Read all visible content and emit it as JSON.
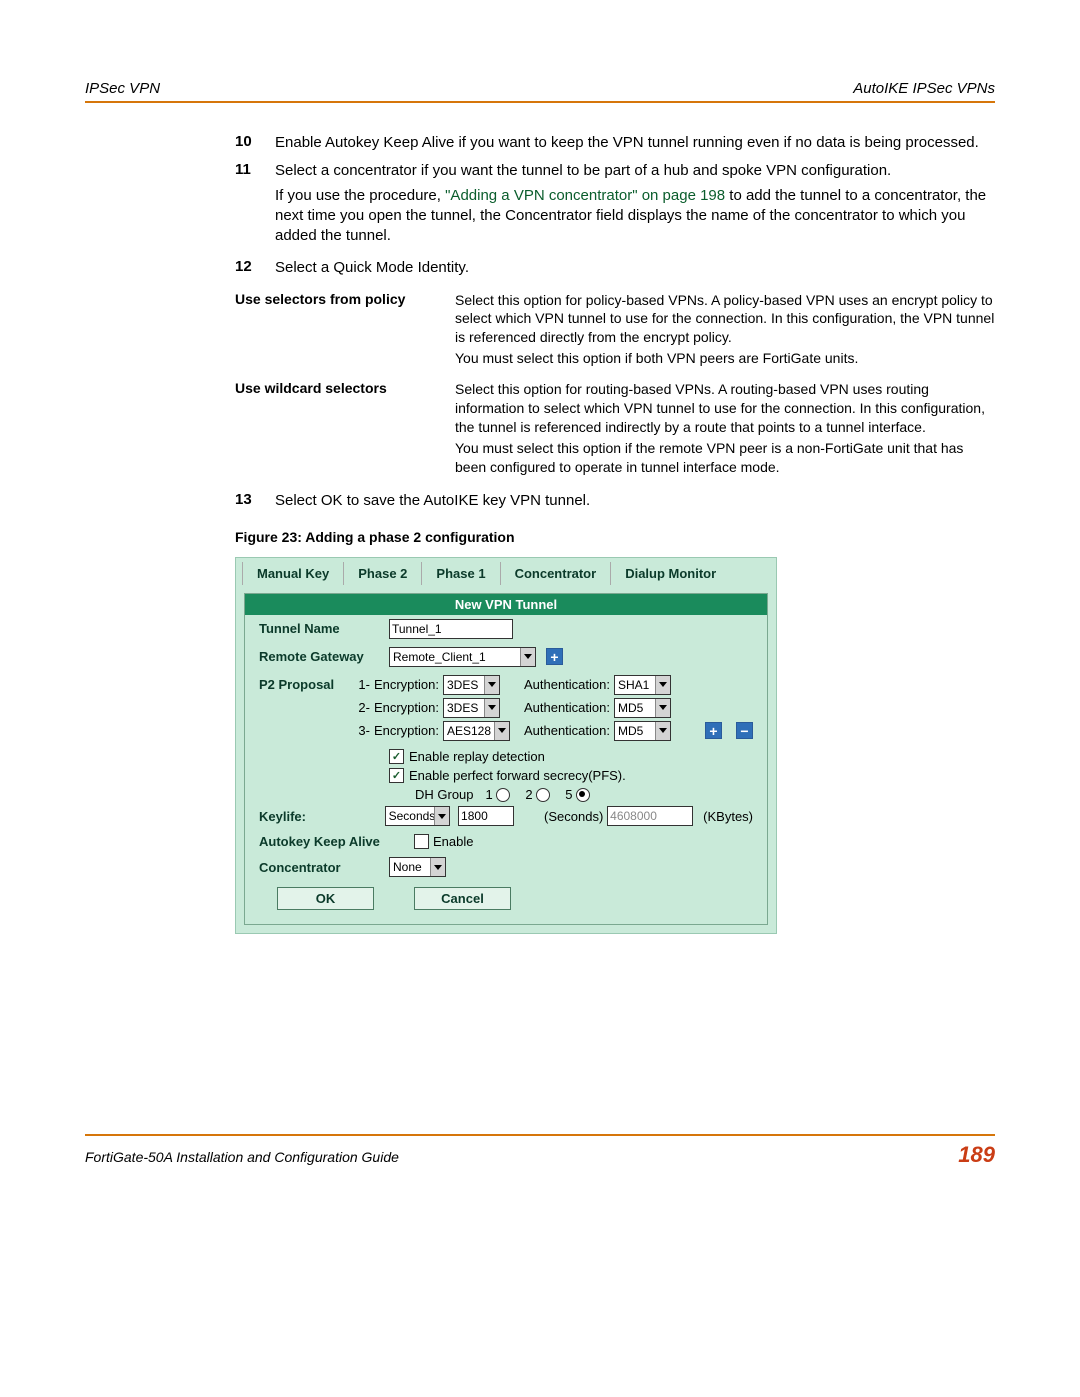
{
  "header": {
    "left": "IPSec VPN",
    "right": "AutoIKE IPSec VPNs"
  },
  "steps": {
    "s10": {
      "num": "10",
      "text": "Enable Autokey Keep Alive if you want to keep the VPN tunnel running even if no data is being processed."
    },
    "s11": {
      "num": "11",
      "p1": "Select a concentrator if you want the tunnel to be part of a hub and spoke VPN configuration.",
      "p2a": "If you use the procedure, ",
      "link": "\"Adding a VPN concentrator\" on page 198",
      "p2b": " to add the tunnel to a concentrator, the next time you open the tunnel, the Concentrator field displays the name of the concentrator to which you added the tunnel."
    },
    "s12": {
      "num": "12",
      "text": "Select a Quick Mode Identity."
    },
    "s13": {
      "num": "13",
      "text": "Select OK to save the AutoIKE key VPN tunnel."
    }
  },
  "defs": {
    "d1": {
      "term": "Use selectors from policy",
      "p1": "Select this option for policy-based VPNs. A policy-based VPN uses an encrypt policy to select which VPN tunnel to use for the connection. In this configuration, the VPN tunnel is referenced directly from the encrypt policy.",
      "p2": "You must select this option if both VPN peers are FortiGate units."
    },
    "d2": {
      "term": "Use wildcard selectors",
      "p1": "Select this option for routing-based VPNs. A routing-based VPN uses routing information to select which VPN tunnel to use for the connection. In this configuration, the tunnel is referenced indirectly by a route that points to a tunnel interface.",
      "p2": "You must select this option if the remote VPN peer is a non-FortiGate unit that has been configured to operate in tunnel interface mode."
    }
  },
  "fig_caption": "Figure 23: Adding a phase 2 configuration",
  "ui": {
    "tabs": [
      "Manual Key",
      "Phase 2",
      "Phase 1",
      "Concentrator",
      "Dialup Monitor"
    ],
    "panel_title": "New VPN Tunnel",
    "labels": {
      "tunnel_name": "Tunnel Name",
      "remote_gateway": "Remote Gateway",
      "p2_proposal": "P2 Proposal",
      "keylife": "Keylife:",
      "autokey": "Autokey Keep Alive",
      "concentrator": "Concentrator",
      "enable": "Enable",
      "encryption_pre": "Encryption:",
      "authentication": "Authentication:",
      "replay": "Enable replay detection",
      "pfs": "Enable perfect forward secrecy(PFS).",
      "dh_group": "DH Group",
      "seconds_unit": "(Seconds)",
      "kbytes_unit": "(KBytes)"
    },
    "values": {
      "tunnel_name": "Tunnel_1",
      "remote_gateway": "Remote_Client_1",
      "enc1": "3DES",
      "auth1": "SHA1",
      "enc2": "3DES",
      "auth2": "MD5",
      "enc3": "AES128",
      "auth3": "MD5",
      "keylife_unit": "Seconds",
      "keylife_seconds": "1800",
      "keylife_kbytes": "4608000",
      "concentrator": "None",
      "dh_options": [
        "1",
        "2",
        "5"
      ],
      "dh_selected": "5"
    },
    "buttons": {
      "ok": "OK",
      "cancel": "Cancel"
    }
  },
  "footer": {
    "guide": "FortiGate-50A Installation and Configuration Guide",
    "page": "189"
  }
}
